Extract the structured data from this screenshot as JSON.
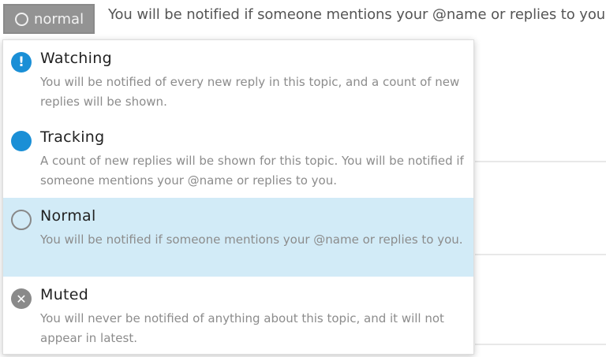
{
  "notification_button": {
    "label": "normal",
    "icon": "circle-outline-icon"
  },
  "status_message": "You will be notified if someone mentions your @name or replies to you.",
  "menu": {
    "items": [
      {
        "title": "Watching",
        "description": "You will be notified of every new reply in this topic, and a count of new replies will be shown.",
        "icon": "exclamation-icon"
      },
      {
        "title": "Tracking",
        "description": "A count of new replies will be shown for this topic. You will be notified if someone mentions your @name or replies to you.",
        "icon": "filled-circle-icon"
      },
      {
        "title": "Normal",
        "description": "You will be notified if someone mentions your @name or replies to you.",
        "icon": "circle-outline-icon",
        "selected": true
      },
      {
        "title": "Muted",
        "description": "You will never be notified of anything about this topic, and it will not appear in latest.",
        "icon": "x-circle-icon"
      }
    ]
  },
  "colors": {
    "accent": "#1a8fd6",
    "selected_bg": "#d2ebf7",
    "button_bg": "#939393"
  }
}
